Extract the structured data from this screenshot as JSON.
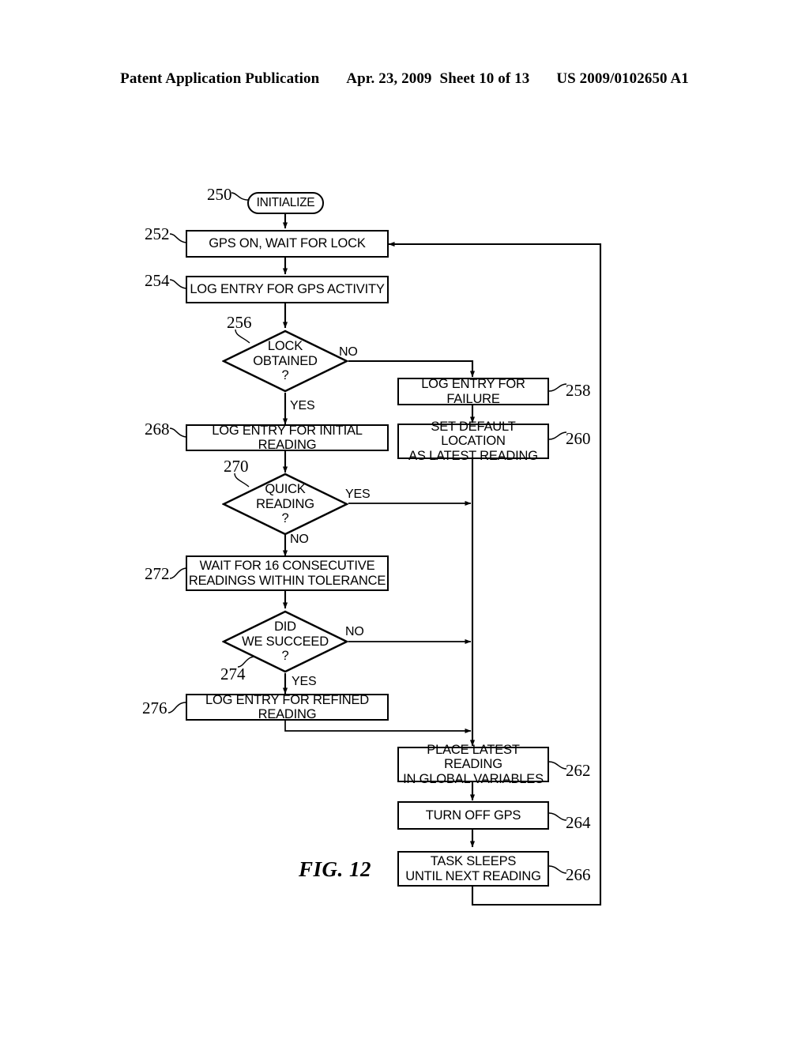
{
  "header": {
    "publication": "Patent Application Publication",
    "date": "Apr. 23, 2009",
    "sheet": "Sheet 10 of 13",
    "patent_number": "US 2009/0102650 A1"
  },
  "figure": {
    "caption": "FIG. 12",
    "nodes": [
      {
        "id": "250",
        "type": "terminator",
        "label": "INITIALIZE"
      },
      {
        "id": "252",
        "type": "process",
        "label": "GPS ON, WAIT FOR LOCK"
      },
      {
        "id": "254",
        "type": "process",
        "label": "LOG ENTRY FOR GPS ACTIVITY"
      },
      {
        "id": "256",
        "type": "decision",
        "label": "LOCK\nOBTAINED\n?"
      },
      {
        "id": "258",
        "type": "process",
        "label": "LOG ENTRY FOR FAILURE"
      },
      {
        "id": "260",
        "type": "process",
        "label": "SET DEFAULT LOCATION\nAS LATEST READING"
      },
      {
        "id": "262",
        "type": "process",
        "label": "PLACE LATEST READING\nIN GLOBAL VARIABLES"
      },
      {
        "id": "264",
        "type": "process",
        "label": "TURN OFF GPS"
      },
      {
        "id": "266",
        "type": "process",
        "label": "TASK SLEEPS\nUNTIL NEXT READING"
      },
      {
        "id": "268",
        "type": "process",
        "label": "LOG ENTRY FOR INITIAL READING"
      },
      {
        "id": "270",
        "type": "decision",
        "label": "QUICK\nREADING\n?"
      },
      {
        "id": "272",
        "type": "process",
        "label": "WAIT FOR 16 CONSECUTIVE\nREADINGS WITHIN TOLERANCE"
      },
      {
        "id": "274",
        "type": "decision",
        "label": "DID\nWE SUCCEED\n?"
      },
      {
        "id": "276",
        "type": "process",
        "label": "LOG ENTRY FOR REFINED READING"
      }
    ],
    "branch_labels": {
      "lock_no": "NO",
      "lock_yes": "YES",
      "quick_yes": "YES",
      "quick_no": "NO",
      "succeed_no": "NO",
      "succeed_yes": "YES"
    }
  }
}
